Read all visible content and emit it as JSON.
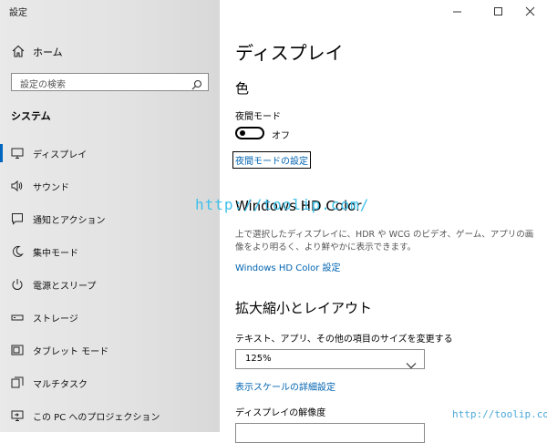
{
  "app": {
    "title": "設定"
  },
  "window": {
    "minimize_icon": "minimize-icon",
    "maximize_icon": "maximize-icon",
    "close_icon": "close-icon"
  },
  "sidebar": {
    "home": {
      "icon": "home-icon",
      "label": "ホーム"
    },
    "search": {
      "placeholder": "設定の検索",
      "icon": "search-icon"
    },
    "section": "システム",
    "items": [
      {
        "icon": "monitor-icon",
        "label": "ディスプレイ",
        "active": true
      },
      {
        "icon": "speaker-icon",
        "label": "サウンド"
      },
      {
        "icon": "notification-icon",
        "label": "通知とアクション"
      },
      {
        "icon": "moon-icon",
        "label": "集中モード"
      },
      {
        "icon": "power-icon",
        "label": "電源とスリープ"
      },
      {
        "icon": "storage-icon",
        "label": "ストレージ"
      },
      {
        "icon": "tablet-icon",
        "label": "タブレット モード"
      },
      {
        "icon": "multitask-icon",
        "label": "マルチタスク"
      },
      {
        "icon": "projection-icon",
        "label": "この PC へのプロジェクション"
      }
    ]
  },
  "main": {
    "title": "ディスプレイ",
    "color_section": "色",
    "night_light_label": "夜間モード",
    "night_light_state": "オフ",
    "night_light_link": "夜間モードの設定",
    "hdr_heading": "Windows HD Color",
    "hdr_desc": "上で選択したディスプレイに、HDR や WCG のビデオ、ゲーム、アプリの画像をより明るく、より鮮やかに表示できます。",
    "hdr_link": "Windows HD Color 設定",
    "scale_heading": "拡大縮小とレイアウト",
    "scale_label": "テキスト、アプリ、その他の項目のサイズを変更する",
    "scale_value": "125%",
    "scale_link": "表示スケールの詳細設定",
    "resolution_label": "ディスプレイの解像度"
  },
  "watermark": {
    "center": "http://toolip.com/",
    "corner": "http://toolip.com"
  },
  "colors": {
    "accent": "#0067c0",
    "link": "#0063b1",
    "watermark": "#3ec1ea"
  }
}
